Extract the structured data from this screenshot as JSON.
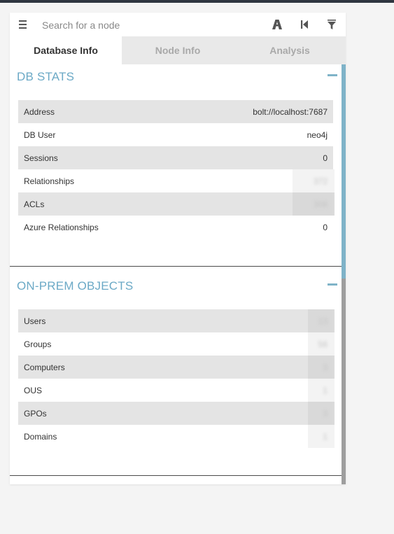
{
  "search": {
    "placeholder": "Search for a node"
  },
  "icons": {
    "menu": "menu-icon",
    "pathfinding": "path-icon",
    "back": "step-backward-icon",
    "filter": "filter-icon"
  },
  "tabs": [
    {
      "label": "Database Info",
      "active": true
    },
    {
      "label": "Node Info",
      "active": false
    },
    {
      "label": "Analysis",
      "active": false
    }
  ],
  "sections": {
    "db_stats": {
      "title": "DB STATS",
      "rows": [
        {
          "label": "Address",
          "value": "bolt://localhost:7687"
        },
        {
          "label": "DB User",
          "value": "neo4j"
        },
        {
          "label": "Sessions",
          "value": "0"
        },
        {
          "label": "Relationships",
          "value": "372"
        },
        {
          "label": "ACLs",
          "value": "308"
        },
        {
          "label": "Azure Relationships",
          "value": "0"
        }
      ]
    },
    "on_prem": {
      "title": "ON-PREM OBJECTS",
      "rows": [
        {
          "label": "Users",
          "value": "13"
        },
        {
          "label": "Groups",
          "value": "56"
        },
        {
          "label": "Computers",
          "value": "3"
        },
        {
          "label": "OUS",
          "value": "1"
        },
        {
          "label": "GPOs",
          "value": "3"
        },
        {
          "label": "Domains",
          "value": "1"
        }
      ]
    }
  },
  "colors": {
    "accent": "#6ba9c6",
    "row_shade": "#e4e4e4",
    "tab_inactive_bg": "#e9e9e9"
  }
}
